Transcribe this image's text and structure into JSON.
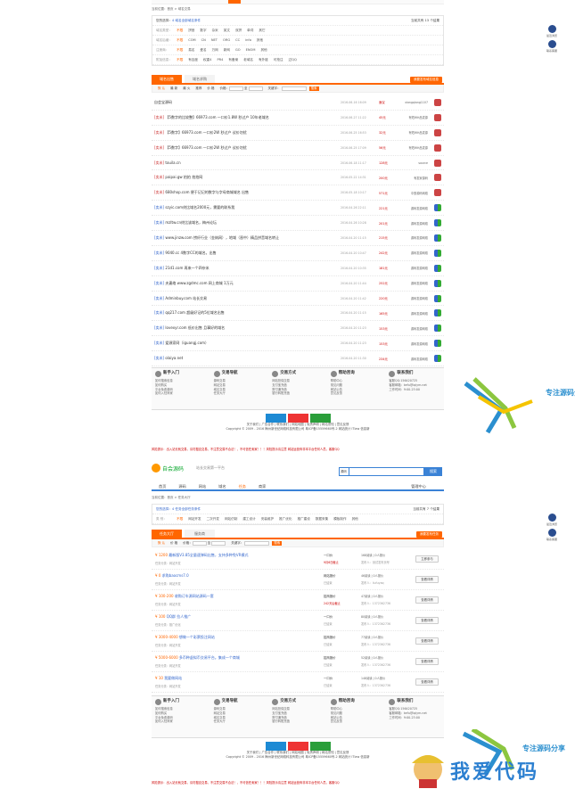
{
  "top_section": {
    "breadcrumb": "当前位置：首页 > 域名交易",
    "filter_header": {
      "selected_label": "您的选择：",
      "selected_value": "4 域名全部域名条件",
      "count_text": "当前共有 13 个结果"
    },
    "filters": [
      {
        "key": "域名类型：",
        "options": [
          "不限",
          "拼音",
          "数字",
          "杂米",
          "英文",
          "双拼",
          "单词",
          "其它"
        ]
      },
      {
        "key": "域名后缀：",
        "options": [
          "不限",
          "COM",
          "CN",
          "NET",
          "ORG",
          "CC",
          "info",
          "其他"
        ]
      },
      {
        "key": "注册商：",
        "options": [
          "不限",
          "易名",
          "爱名",
          "万网",
          "新网",
          "GO",
          "ENOM",
          "其他"
        ]
      },
      {
        "key": "附加信息：",
        "options": [
          "不限",
          "有百度",
          "权重4",
          "PR4",
          "有备案",
          "老域名",
          "有外链",
          "可抢注",
          "过QQ"
        ]
      }
    ],
    "tabs": [
      "域名出售",
      "域名求购"
    ],
    "publish_button": "我要发布域名信息",
    "sort_bar": {
      "items": [
        "默 认",
        "最 新",
        "最 火",
        "推荐",
        "价 格",
        "价格：",
        "至",
        "关键字："
      ],
      "button": "搜索"
    },
    "rows": [
      {
        "tag": "",
        "title": "自会宝源码",
        "date": "2016-06-16 16:09",
        "price": "面议",
        "user": "xiangqiang1107",
        "avatar": "r"
      },
      {
        "tag": "[卖米]",
        "title": "【5数字的比较整】66973.com 一口价1.8W 秒过户 10年老域名",
        "date": "2016-06-27 11:22",
        "price": "45元",
        "user": "有短WH品发源",
        "avatar": "r"
      },
      {
        "tag": "[卖米]",
        "title": "【5数字】66973.com 一口价2W 秒过户 议价勿扰",
        "date": "2016-06-25 16:53",
        "price": "32元",
        "user": "有短WH品发源",
        "avatar": "r"
      },
      {
        "tag": "[卖米]",
        "title": "【5数字】66973.com 一口价2W 秒过户 议价勿扰",
        "date": "2016-06-25 17:09",
        "price": "56元",
        "user": "有短WH品发源",
        "avatar": "r"
      },
      {
        "tag": "[卖米]",
        "title": "touila.cn",
        "date": "2016-06-18 11:17",
        "price": "128元",
        "user": "source",
        "avatar": "r"
      },
      {
        "tag": "[卖米]",
        "title": "paipai.gw 拍拍 拍拍网",
        "date": "2016-05-22 14:31",
        "price": "200元",
        "user": "有发家源码",
        "avatar": "r"
      },
      {
        "tag": "[卖米]",
        "title": "680shop.com 便于记记的数字与字母商城域名 出售",
        "date": "2016-05-18 10:17",
        "price": "571元",
        "user": "中惠源码网络",
        "avatar": "r"
      },
      {
        "tag": "[卖米]",
        "title": "szyic.com终比域名2000元，需要的联系我",
        "date": "2016-04-26 22:11",
        "price": "221元",
        "user": "源码发源网络",
        "avatar": "g"
      },
      {
        "tag": "[卖米]",
        "title": "mzltw.cn终比该域名，梅州论坛",
        "date": "2016-04-26 10:28",
        "price": "201元",
        "user": "源码发源网络",
        "avatar": "g"
      },
      {
        "tag": "[卖米]",
        "title": "www.jinzw.com 捞纤行业（金纳网），地域（晋中）精品拼音域名转让",
        "date": "2016-04-20 11:15",
        "price": "215元",
        "user": "源码发源网络",
        "avatar": "g"
      },
      {
        "tag": "[卖米]",
        "title": "9040.cc 4数字CC的域名。出售",
        "date": "2016-04-20 10:47",
        "price": "242元",
        "user": "源码发源网络",
        "avatar": "g"
      },
      {
        "tag": "[卖米]",
        "title": "21d1.com 再来一个四杂米",
        "date": "2016-04-20 10:35",
        "price": "181元",
        "user": "源码发源网络",
        "avatar": "g"
      },
      {
        "tag": "[卖米]",
        "title": "夫妻络 www.zgdmc.com 网上商城 1万元",
        "date": "2016-04-20 11:44",
        "price": "252元",
        "user": "源码发源网络",
        "avatar": "g"
      },
      {
        "tag": "[卖米]",
        "title": "Adminbuy.com 站长交易",
        "date": "2016-04-20 11:42",
        "price": "220元",
        "user": "源码发源网络",
        "avatar": "g"
      },
      {
        "tag": "[卖米]",
        "title": "qq217.com 超级好记的5位域名出售",
        "date": "2016-04-20 11:15",
        "price": "165元",
        "user": "源码发源网络",
        "avatar": "g"
      },
      {
        "tag": "[卖米]",
        "title": "lovexyr.com 低价出售 且事好的域名",
        "date": "2016-04-20 11:23",
        "price": "153元",
        "user": "源码发源网络",
        "avatar": "g"
      },
      {
        "tag": "[卖米]",
        "title": "爱源家网（iguangj.com）",
        "date": "2016-04-20 11:23",
        "price": "153元",
        "user": "源码发源网络",
        "avatar": "g"
      },
      {
        "tag": "[卖米]",
        "title": "olaiya.net",
        "date": "2016-04-20 11:30",
        "price": "234元",
        "user": "源码发源网络",
        "avatar": "g"
      }
    ]
  },
  "footer": {
    "cols": [
      {
        "title": "新手入门",
        "items": [
          "如何搜索信息",
          "如何购买",
          "平台免费源码",
          "如何入驻商家"
        ]
      },
      {
        "title": "交易导航",
        "items": [
          "源码交易",
          "网站交易",
          "域名交易",
          "任务大厅"
        ]
      },
      {
        "title": "交易方式",
        "items": [
          "网站担保交易",
          "支付宝充值",
          "财付通充值",
          "银行转账充值"
        ]
      },
      {
        "title": "帮助咨询",
        "items": [
          "帮助中心",
          "常见问题",
          "网站公告",
          "意见反馈"
        ]
      },
      {
        "title": "联系我们",
        "items": [
          "客服QQ:156420725",
          "客服邮箱：kefu@iqiym.net",
          "工作时间：9:00-23:00"
        ]
      }
    ],
    "badges": [
      "安全联盟",
      "认证企业",
      "网站信用"
    ],
    "links": "关于我们 | 广告合作 | 联系我们 | 网站地图 | 免责声明 | 网站须知 | 意见反馈",
    "copyright": "Copyright © 2009 - 2016 梅州新世纪网络科技有限公司 粤ICP备15559660号-2 网站统计 ITlaw 信息新",
    "notice": "风险提示：出入站长就交易，请勿擅自交易，不注意交易不合法！，不可信任卖家！！！风险提示请注意 网站运营商非本平台任何人员。客服QQ"
  },
  "header2": {
    "logo_text": "自会源码",
    "slogan": "站长交易第一平台",
    "search_select": "源码",
    "search_button": "搜索",
    "top_links": [
      "登录",
      "注册",
      "我的自会",
      "网站导航"
    ],
    "nav": [
      "首页",
      "源码",
      "网站",
      "域名",
      "任务",
      "商家"
    ],
    "nav_active": "任务",
    "nav_right": "管理中心"
  },
  "task_section": {
    "breadcrumb": "当前位置：首页 > 任务大厅",
    "selected_value": "您的选择：4 任务全部任务条件",
    "count_text": "当前共有 7 个结果",
    "type_key": "类 别：",
    "types": [
      "不限",
      "网站开发",
      "二次开发",
      "网站仿制",
      "建工设计",
      "安装维护",
      "推广优化",
      "推广建设",
      "数据采集",
      "模板制作",
      "其他"
    ],
    "tabs": [
      "任务大厅",
      "服务商"
    ],
    "publish_button": "我要发布任务",
    "sort_bar": {
      "items": [
        "默 认",
        "价 格",
        "价格：",
        "至",
        "关键字："
      ],
      "button": "搜索"
    },
    "tasks": [
      {
        "price": "¥ 1200",
        "title": "最新版V3.85全量速弹码出售，支持多种免VR模式",
        "sub": "任务分类：网站开发",
        "mode": "一口价",
        "status": "9月6日截止",
        "c1": "168阅读 | 0人报价",
        "c2": "发布人：测试发布页号",
        "btn": "立即参与"
      },
      {
        "price": "¥ 0",
        "title": "求购baocms7.0",
        "sub": "任务分类：网站开发",
        "mode": "网站报价",
        "status": "已结束",
        "c1": "46阅读 | 0人报价",
        "c2": "发布人：liufuyaq",
        "btn": "查看详情"
      },
      {
        "price": "¥ 100-200",
        "title": "收购订车源网站源码一套",
        "sub": "任务分类：网站开发",
        "mode": "招商报价",
        "status": "242天后截止",
        "c1": "47阅读 | 0人报价",
        "c2": "发布人：1372362736",
        "btn": "查看详情"
      },
      {
        "price": "¥ 100",
        "title": "QQ群 拉人推广",
        "sub": "任务分类：推广优化",
        "mode": "一口价",
        "status": "已结束",
        "c1": "80阅读 | 0人报价",
        "c2": "发布人：1372362736",
        "btn": "查看详情"
      },
      {
        "price": "¥ 3000-4000",
        "title": "想做一个彩票投注网站",
        "sub": "任务分类：网站开发",
        "mode": "招商报价",
        "status": "已结束",
        "c1": "77阅读 | 0人报价",
        "c2": "发布人：1372362736",
        "btn": "查看详情"
      },
      {
        "price": "¥ 5000-6000",
        "title": "多币种虚拟币交易平台。集成一个商城",
        "sub": "任务分类：网站开发",
        "mode": "招商报价",
        "status": "已结束",
        "c1": "52阅读 | 0人报价",
        "c2": "发布人：1372362736",
        "btn": "查看详情"
      },
      {
        "price": "¥ 10",
        "title": "我要做网站",
        "sub": "任务分类：网站开发",
        "mode": "一口价",
        "status": "已结束",
        "c1": "148阅读 | 0人报价",
        "c2": "发布人：1372362736",
        "btn": "查看详情"
      }
    ]
  },
  "side_float": {
    "items": [
      "最近浏览",
      "联系客服"
    ]
  },
  "watermark": {
    "share_text": "专注源码分享",
    "big_text": "我爱代码"
  },
  "colors": {
    "accent": "#ff6600",
    "blue": "#3a82d6",
    "watermark_blue": "#2b8fcf"
  }
}
